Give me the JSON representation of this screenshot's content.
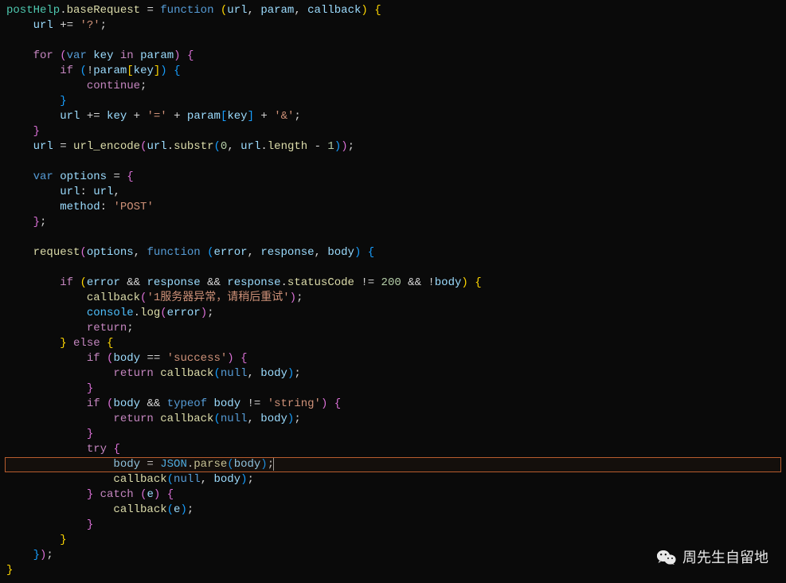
{
  "code": {
    "lines": [
      [
        [
          "tk-obj",
          "postHelp"
        ],
        [
          "tk-op",
          "."
        ],
        [
          "tk-prop",
          "baseRequest"
        ],
        [
          "tk-op",
          " = "
        ],
        [
          "tk-kw",
          "function"
        ],
        [
          "tk-punc",
          " "
        ],
        [
          "tk-brace",
          "("
        ],
        [
          "tk-param",
          "url"
        ],
        [
          "tk-punc",
          ", "
        ],
        [
          "tk-param",
          "param"
        ],
        [
          "tk-punc",
          ", "
        ],
        [
          "tk-param",
          "callback"
        ],
        [
          "tk-brace",
          ")"
        ],
        [
          "tk-punc",
          " "
        ],
        [
          "tk-brace",
          "{"
        ]
      ],
      [
        [
          "",
          "    "
        ],
        [
          "tk-var",
          "url"
        ],
        [
          "tk-op",
          " += "
        ],
        [
          "tk-str",
          "'?'"
        ],
        [
          "tk-punc",
          ";"
        ]
      ],
      [
        [
          "",
          ""
        ]
      ],
      [
        [
          "",
          "    "
        ],
        [
          "tk-kw2",
          "for"
        ],
        [
          "tk-punc",
          " "
        ],
        [
          "tk-brace2",
          "("
        ],
        [
          "tk-kw",
          "var"
        ],
        [
          "tk-punc",
          " "
        ],
        [
          "tk-var",
          "key"
        ],
        [
          "tk-punc",
          " "
        ],
        [
          "tk-kw2",
          "in"
        ],
        [
          "tk-punc",
          " "
        ],
        [
          "tk-var",
          "param"
        ],
        [
          "tk-brace2",
          ")"
        ],
        [
          "tk-punc",
          " "
        ],
        [
          "tk-brace2",
          "{"
        ]
      ],
      [
        [
          "",
          "        "
        ],
        [
          "tk-kw2",
          "if"
        ],
        [
          "tk-punc",
          " "
        ],
        [
          "tk-brace3",
          "("
        ],
        [
          "tk-op",
          "!"
        ],
        [
          "tk-var",
          "param"
        ],
        [
          "tk-brace",
          "["
        ],
        [
          "tk-var",
          "key"
        ],
        [
          "tk-brace",
          "]"
        ],
        [
          "tk-brace3",
          ")"
        ],
        [
          "tk-punc",
          " "
        ],
        [
          "tk-brace3",
          "{"
        ]
      ],
      [
        [
          "",
          "            "
        ],
        [
          "tk-kw2",
          "continue"
        ],
        [
          "tk-punc",
          ";"
        ]
      ],
      [
        [
          "",
          "        "
        ],
        [
          "tk-brace3",
          "}"
        ]
      ],
      [
        [
          "",
          "        "
        ],
        [
          "tk-var",
          "url"
        ],
        [
          "tk-op",
          " += "
        ],
        [
          "tk-var",
          "key"
        ],
        [
          "tk-op",
          " + "
        ],
        [
          "tk-str",
          "'='"
        ],
        [
          "tk-op",
          " + "
        ],
        [
          "tk-var",
          "param"
        ],
        [
          "tk-brace3",
          "["
        ],
        [
          "tk-var",
          "key"
        ],
        [
          "tk-brace3",
          "]"
        ],
        [
          "tk-op",
          " + "
        ],
        [
          "tk-str",
          "'&'"
        ],
        [
          "tk-punc",
          ";"
        ]
      ],
      [
        [
          "",
          "    "
        ],
        [
          "tk-brace2",
          "}"
        ]
      ],
      [
        [
          "",
          "    "
        ],
        [
          "tk-var",
          "url"
        ],
        [
          "tk-op",
          " = "
        ],
        [
          "tk-func",
          "url_encode"
        ],
        [
          "tk-brace2",
          "("
        ],
        [
          "tk-var",
          "url"
        ],
        [
          "tk-op",
          "."
        ],
        [
          "tk-func",
          "substr"
        ],
        [
          "tk-brace3",
          "("
        ],
        [
          "tk-num",
          "0"
        ],
        [
          "tk-punc",
          ", "
        ],
        [
          "tk-var",
          "url"
        ],
        [
          "tk-op",
          "."
        ],
        [
          "tk-prop",
          "length"
        ],
        [
          "tk-op",
          " - "
        ],
        [
          "tk-num",
          "1"
        ],
        [
          "tk-brace3",
          ")"
        ],
        [
          "tk-brace2",
          ")"
        ],
        [
          "tk-punc",
          ";"
        ]
      ],
      [
        [
          "",
          ""
        ]
      ],
      [
        [
          "",
          "    "
        ],
        [
          "tk-kw",
          "var"
        ],
        [
          "tk-punc",
          " "
        ],
        [
          "tk-var",
          "options"
        ],
        [
          "tk-op",
          " = "
        ],
        [
          "tk-brace2",
          "{"
        ]
      ],
      [
        [
          "",
          "        "
        ],
        [
          "tk-var",
          "url"
        ],
        [
          "tk-punc",
          ": "
        ],
        [
          "tk-var",
          "url"
        ],
        [
          "tk-punc",
          ","
        ]
      ],
      [
        [
          "",
          "        "
        ],
        [
          "tk-var",
          "method"
        ],
        [
          "tk-punc",
          ": "
        ],
        [
          "tk-str",
          "'POST'"
        ]
      ],
      [
        [
          "",
          "    "
        ],
        [
          "tk-brace2",
          "}"
        ],
        [
          "tk-punc",
          ";"
        ]
      ],
      [
        [
          "",
          ""
        ]
      ],
      [
        [
          "",
          "    "
        ],
        [
          "tk-func",
          "request"
        ],
        [
          "tk-brace2",
          "("
        ],
        [
          "tk-var",
          "options"
        ],
        [
          "tk-punc",
          ", "
        ],
        [
          "tk-kw",
          "function"
        ],
        [
          "tk-punc",
          " "
        ],
        [
          "tk-brace3",
          "("
        ],
        [
          "tk-param",
          "error"
        ],
        [
          "tk-punc",
          ", "
        ],
        [
          "tk-param",
          "response"
        ],
        [
          "tk-punc",
          ", "
        ],
        [
          "tk-param",
          "body"
        ],
        [
          "tk-brace3",
          ")"
        ],
        [
          "tk-punc",
          " "
        ],
        [
          "tk-brace3",
          "{"
        ]
      ],
      [
        [
          "",
          ""
        ]
      ],
      [
        [
          "",
          "        "
        ],
        [
          "tk-kw2",
          "if"
        ],
        [
          "tk-punc",
          " "
        ],
        [
          "tk-brace",
          "("
        ],
        [
          "tk-var",
          "error"
        ],
        [
          "tk-op",
          " && "
        ],
        [
          "tk-var",
          "response"
        ],
        [
          "tk-op",
          " && "
        ],
        [
          "tk-var",
          "response"
        ],
        [
          "tk-op",
          "."
        ],
        [
          "tk-prop",
          "statusCode"
        ],
        [
          "tk-op",
          " != "
        ],
        [
          "tk-num",
          "200"
        ],
        [
          "tk-op",
          " && !"
        ],
        [
          "tk-var",
          "body"
        ],
        [
          "tk-brace",
          ")"
        ],
        [
          "tk-punc",
          " "
        ],
        [
          "tk-brace",
          "{"
        ]
      ],
      [
        [
          "",
          "            "
        ],
        [
          "tk-func",
          "callback"
        ],
        [
          "tk-brace2",
          "("
        ],
        [
          "tk-str",
          "'1服务器异常，请稍后重试'"
        ],
        [
          "tk-brace2",
          ")"
        ],
        [
          "tk-punc",
          ";"
        ]
      ],
      [
        [
          "",
          "            "
        ],
        [
          "tk-global",
          "console"
        ],
        [
          "tk-op",
          "."
        ],
        [
          "tk-func",
          "log"
        ],
        [
          "tk-brace2",
          "("
        ],
        [
          "tk-var",
          "error"
        ],
        [
          "tk-brace2",
          ")"
        ],
        [
          "tk-punc",
          ";"
        ]
      ],
      [
        [
          "",
          "            "
        ],
        [
          "tk-kw2",
          "return"
        ],
        [
          "tk-punc",
          ";"
        ]
      ],
      [
        [
          "",
          "        "
        ],
        [
          "tk-brace",
          "}"
        ],
        [
          "tk-punc",
          " "
        ],
        [
          "tk-kw2",
          "else"
        ],
        [
          "tk-punc",
          " "
        ],
        [
          "tk-brace",
          "{"
        ]
      ],
      [
        [
          "",
          "            "
        ],
        [
          "tk-kw2",
          "if"
        ],
        [
          "tk-punc",
          " "
        ],
        [
          "tk-brace2",
          "("
        ],
        [
          "tk-var",
          "body"
        ],
        [
          "tk-op",
          " == "
        ],
        [
          "tk-str",
          "'success'"
        ],
        [
          "tk-brace2",
          ")"
        ],
        [
          "tk-punc",
          " "
        ],
        [
          "tk-brace2",
          "{"
        ]
      ],
      [
        [
          "",
          "                "
        ],
        [
          "tk-kw2",
          "return"
        ],
        [
          "tk-punc",
          " "
        ],
        [
          "tk-func",
          "callback"
        ],
        [
          "tk-brace3",
          "("
        ],
        [
          "tk-const",
          "null"
        ],
        [
          "tk-punc",
          ", "
        ],
        [
          "tk-var",
          "body"
        ],
        [
          "tk-brace3",
          ")"
        ],
        [
          "tk-punc",
          ";"
        ]
      ],
      [
        [
          "",
          "            "
        ],
        [
          "tk-brace2",
          "}"
        ]
      ],
      [
        [
          "",
          "            "
        ],
        [
          "tk-kw2",
          "if"
        ],
        [
          "tk-punc",
          " "
        ],
        [
          "tk-brace2",
          "("
        ],
        [
          "tk-var",
          "body"
        ],
        [
          "tk-op",
          " && "
        ],
        [
          "tk-kw",
          "typeof"
        ],
        [
          "tk-punc",
          " "
        ],
        [
          "tk-var",
          "body"
        ],
        [
          "tk-op",
          " != "
        ],
        [
          "tk-str",
          "'string'"
        ],
        [
          "tk-brace2",
          ")"
        ],
        [
          "tk-punc",
          " "
        ],
        [
          "tk-brace2",
          "{"
        ]
      ],
      [
        [
          "",
          "                "
        ],
        [
          "tk-kw2",
          "return"
        ],
        [
          "tk-punc",
          " "
        ],
        [
          "tk-func",
          "callback"
        ],
        [
          "tk-brace3",
          "("
        ],
        [
          "tk-const",
          "null"
        ],
        [
          "tk-punc",
          ", "
        ],
        [
          "tk-var",
          "body"
        ],
        [
          "tk-brace3",
          ")"
        ],
        [
          "tk-punc",
          ";"
        ]
      ],
      [
        [
          "",
          "            "
        ],
        [
          "tk-brace2",
          "}"
        ]
      ],
      [
        [
          "",
          "            "
        ],
        [
          "tk-kw2",
          "try"
        ],
        [
          "tk-punc",
          " "
        ],
        [
          "tk-brace2",
          "{"
        ]
      ],
      [
        [
          "",
          "                "
        ],
        [
          "tk-var",
          "body"
        ],
        [
          "tk-op",
          " = "
        ],
        [
          "tk-global",
          "JSON"
        ],
        [
          "tk-op",
          "."
        ],
        [
          "tk-func",
          "parse"
        ],
        [
          "tk-brace3",
          "("
        ],
        [
          "tk-var",
          "body"
        ],
        [
          "tk-brace3",
          ")"
        ],
        [
          "tk-punc",
          ";"
        ]
      ],
      [
        [
          "",
          "                "
        ],
        [
          "tk-func",
          "callback"
        ],
        [
          "tk-brace3",
          "("
        ],
        [
          "tk-const",
          "null"
        ],
        [
          "tk-punc",
          ", "
        ],
        [
          "tk-var",
          "body"
        ],
        [
          "tk-brace3",
          ")"
        ],
        [
          "tk-punc",
          ";"
        ]
      ],
      [
        [
          "",
          "            "
        ],
        [
          "tk-brace2",
          "}"
        ],
        [
          "tk-punc",
          " "
        ],
        [
          "tk-kw2",
          "catch"
        ],
        [
          "tk-punc",
          " "
        ],
        [
          "tk-brace2",
          "("
        ],
        [
          "tk-var",
          "e"
        ],
        [
          "tk-brace2",
          ")"
        ],
        [
          "tk-punc",
          " "
        ],
        [
          "tk-brace2",
          "{"
        ]
      ],
      [
        [
          "",
          "                "
        ],
        [
          "tk-func",
          "callback"
        ],
        [
          "tk-brace3",
          "("
        ],
        [
          "tk-var",
          "e"
        ],
        [
          "tk-brace3",
          ")"
        ],
        [
          "tk-punc",
          ";"
        ]
      ],
      [
        [
          "",
          "            "
        ],
        [
          "tk-brace2",
          "}"
        ]
      ],
      [
        [
          "",
          "        "
        ],
        [
          "tk-brace",
          "}"
        ]
      ],
      [
        [
          "",
          "    "
        ],
        [
          "tk-brace3",
          "}"
        ],
        [
          "tk-brace2",
          ")"
        ],
        [
          "tk-punc",
          ";"
        ]
      ],
      [
        [
          "tk-brace",
          "}"
        ]
      ]
    ],
    "highlighted_line_index": 30,
    "cursor_after_highlight": true
  },
  "watermark": {
    "text": "周先生自留地"
  }
}
